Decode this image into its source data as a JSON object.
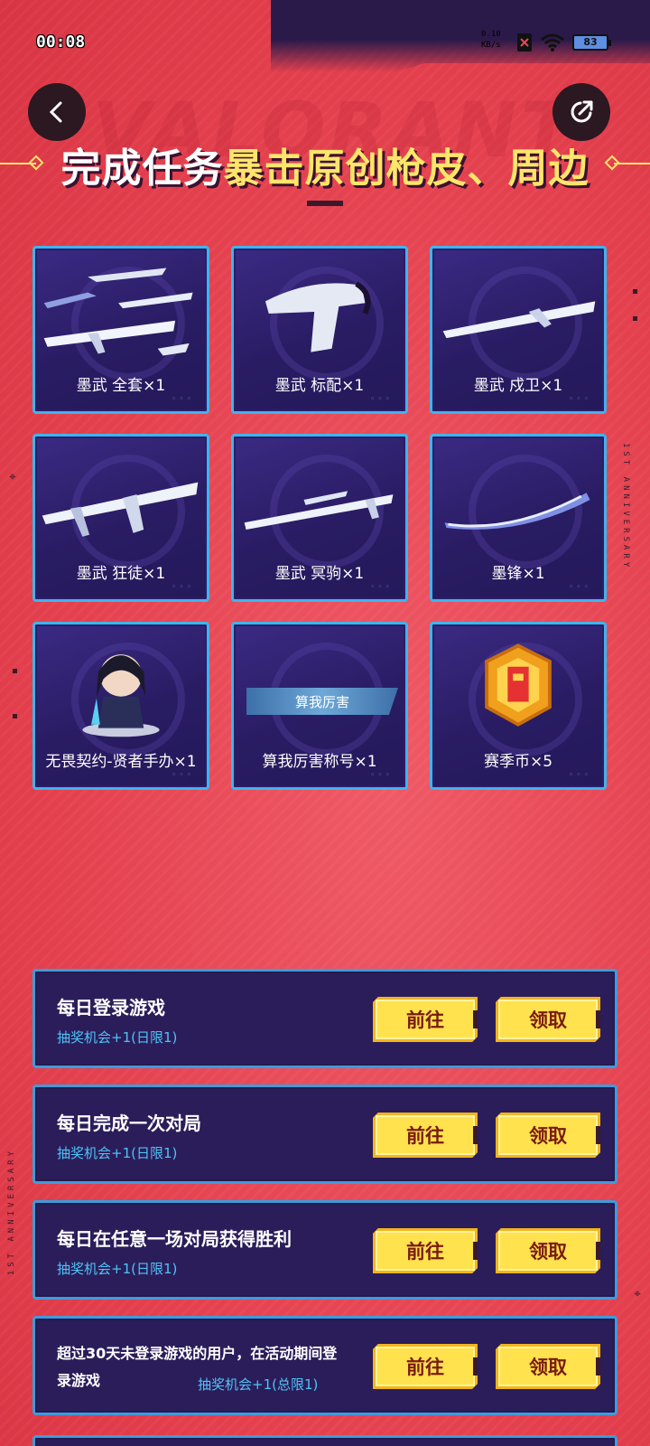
{
  "status_bar": {
    "time": "00:08",
    "net_speed_value": "0.10",
    "net_speed_unit": "KB/s",
    "battery": "83"
  },
  "header": {
    "title_part1": "完成任务",
    "title_part2": "暴击原创枪皮、周边"
  },
  "decor": {
    "logo_text": "VALORANT",
    "side_text": "1ST ANNIVERSARY"
  },
  "rewards": [
    {
      "label": "墨武 全套×1",
      "icon": "weapon-set-icon"
    },
    {
      "label": "墨武 标配×1",
      "icon": "pistol-icon"
    },
    {
      "label": "墨武 戍卫×1",
      "icon": "rifle-icon"
    },
    {
      "label": "墨武 狂徒×1",
      "icon": "rifle-icon"
    },
    {
      "label": "墨武 冥驹×1",
      "icon": "sniper-icon"
    },
    {
      "label": "墨锋×1",
      "icon": "knife-icon"
    },
    {
      "label": "无畏契约-贤者手办×1",
      "icon": "figure-icon"
    },
    {
      "label": "算我厉害称号×1",
      "icon": "title-badge-icon",
      "banner": "算我厉害"
    },
    {
      "label": "赛季币×5",
      "icon": "coin-icon"
    }
  ],
  "tasks": [
    {
      "name": "每日登录游戏",
      "reward": "抽奖机会+1(日限1)",
      "go": "前往",
      "claim": "领取"
    },
    {
      "name": "每日完成一次对局",
      "reward": "抽奖机会+1(日限1)",
      "go": "前往",
      "claim": "领取"
    },
    {
      "name": "每日在任意一场对局获得胜利",
      "reward": "抽奖机会+1(日限1)",
      "go": "前往",
      "claim": "领取"
    },
    {
      "name": "超过30天未登录游戏的用户，在活动期间登录游戏",
      "reward": "抽奖机会+1(总限1)",
      "go": "前往",
      "claim": "领取"
    }
  ],
  "colors": {
    "background": "#e84855",
    "card": "#2b1d5a",
    "card_border": "#3fb4ec",
    "accent_yellow": "#ffe24d",
    "reward_text": "#4fc3f7"
  }
}
